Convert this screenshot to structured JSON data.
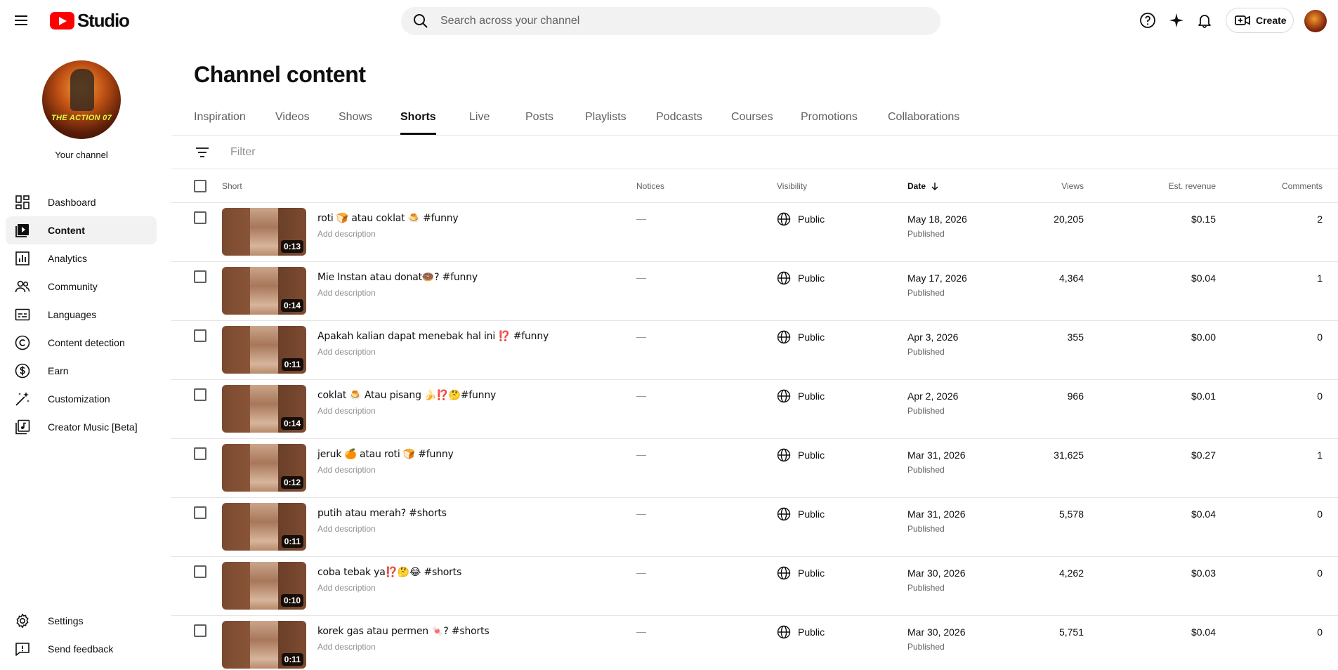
{
  "topbar": {
    "logo_text": "Studio",
    "search_placeholder": "Search across your channel",
    "create_label": "Create"
  },
  "sidebar": {
    "your_channel_label": "Your channel",
    "avatar_text": "THE ACTION 07",
    "items": [
      {
        "label": "Dashboard",
        "icon": "dashboard-icon"
      },
      {
        "label": "Content",
        "icon": "content-icon",
        "active": true
      },
      {
        "label": "Analytics",
        "icon": "analytics-icon"
      },
      {
        "label": "Community",
        "icon": "community-icon"
      },
      {
        "label": "Languages",
        "icon": "languages-icon"
      },
      {
        "label": "Content detection",
        "icon": "content-detection-icon"
      },
      {
        "label": "Earn",
        "icon": "earn-icon"
      },
      {
        "label": "Customization",
        "icon": "customization-icon"
      },
      {
        "label": "Creator Music [Beta]",
        "icon": "creator-music-icon"
      }
    ],
    "bottom_items": [
      {
        "label": "Settings",
        "icon": "settings-icon"
      },
      {
        "label": "Send feedback",
        "icon": "feedback-icon"
      }
    ]
  },
  "main": {
    "title": "Channel content",
    "tabs": [
      "Inspiration",
      "Videos",
      "Shows",
      "Shorts",
      "Live",
      "Posts",
      "Playlists",
      "Podcasts",
      "Courses",
      "Promotions",
      "Collaborations"
    ],
    "active_tab": "Shorts",
    "filter_placeholder": "Filter",
    "columns": {
      "short": "Short",
      "notices": "Notices",
      "visibility": "Visibility",
      "date": "Date",
      "views": "Views",
      "revenue": "Est. revenue",
      "comments": "Comments"
    },
    "rows": [
      {
        "title": "roti 🍞 atau coklat 🍮 #funny",
        "desc": "Add description",
        "duration": "0:13",
        "notice": "—",
        "visibility": "Public",
        "date": "May 18, 2026",
        "status": "Published",
        "views": "20,205",
        "revenue": "$0.15",
        "comments": "2"
      },
      {
        "title": "Mie Instan atau donat🍩? #funny",
        "desc": "Add description",
        "duration": "0:14",
        "notice": "—",
        "visibility": "Public",
        "date": "May 17, 2026",
        "status": "Published",
        "views": "4,364",
        "revenue": "$0.04",
        "comments": "1"
      },
      {
        "title": "Apakah kalian dapat menebak hal ini ⁉️ #funny",
        "desc": "Add description",
        "duration": "0:11",
        "notice": "—",
        "visibility": "Public",
        "date": "Apr 3, 2026",
        "status": "Published",
        "views": "355",
        "revenue": "$0.00",
        "comments": "0"
      },
      {
        "title": "coklat 🍮 Atau pisang 🍌⁉️🤔#funny",
        "desc": "Add description",
        "duration": "0:14",
        "notice": "—",
        "visibility": "Public",
        "date": "Apr 2, 2026",
        "status": "Published",
        "views": "966",
        "revenue": "$0.01",
        "comments": "0"
      },
      {
        "title": "jeruk 🍊 atau roti 🍞 #funny",
        "desc": "Add description",
        "duration": "0:12",
        "notice": "—",
        "visibility": "Public",
        "date": "Mar 31, 2026",
        "status": "Published",
        "views": "31,625",
        "revenue": "$0.27",
        "comments": "1"
      },
      {
        "title": "putih atau merah? #shorts",
        "desc": "Add description",
        "duration": "0:11",
        "notice": "—",
        "visibility": "Public",
        "date": "Mar 31, 2026",
        "status": "Published",
        "views": "5,578",
        "revenue": "$0.04",
        "comments": "0"
      },
      {
        "title": "coba tebak ya⁉️🤔😂 #shorts",
        "desc": "Add description",
        "duration": "0:10",
        "notice": "—",
        "visibility": "Public",
        "date": "Mar 30, 2026",
        "status": "Published",
        "views": "4,262",
        "revenue": "$0.03",
        "comments": "0"
      },
      {
        "title": "korek gas atau permen 🍬? #shorts",
        "desc": "Add description",
        "duration": "0:11",
        "notice": "—",
        "visibility": "Public",
        "date": "Mar 30, 2026",
        "status": "Published",
        "views": "5,751",
        "revenue": "$0.04",
        "comments": "0"
      }
    ]
  },
  "colors": {
    "brand_red": "#ff0000",
    "text_primary": "#0f0f0f",
    "text_secondary": "#606060",
    "active_bg": "#f2f2f2"
  }
}
